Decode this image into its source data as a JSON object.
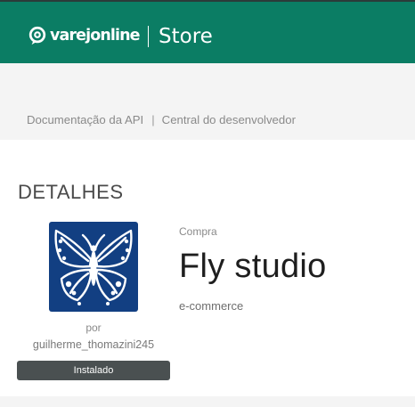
{
  "header": {
    "logo_text": "varejonline",
    "logo_icon": "varejonline-logo-icon",
    "store_label": "Store",
    "background_color": "#0b7d64"
  },
  "nav": {
    "links": [
      {
        "label": "Documentação da API"
      },
      {
        "label": "Central do desenvolvedor"
      }
    ],
    "separator": "|"
  },
  "details": {
    "section_title": "DETALHES",
    "app_icon": "butterfly-icon",
    "by_label": "por",
    "author": "guilherme_thomazini245",
    "status_badge": "Instalado",
    "purchase_type": "Compra",
    "app_name": "Fly studio",
    "category": "e-commerce"
  }
}
